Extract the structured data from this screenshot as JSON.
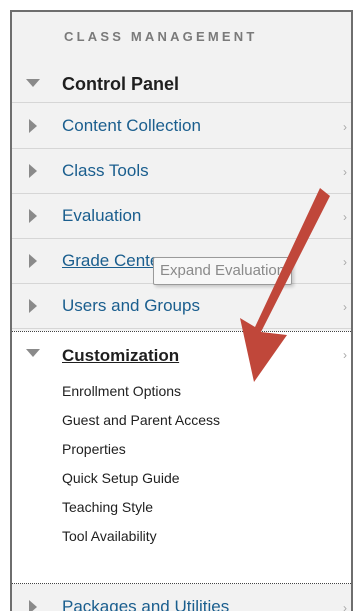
{
  "section_heading": "CLASS MANAGEMENT",
  "control_panel": {
    "label": "Control Panel"
  },
  "items": [
    {
      "label": "Content Collection"
    },
    {
      "label": "Class Tools"
    },
    {
      "label": "Evaluation"
    },
    {
      "label": "Grade Center"
    },
    {
      "label": "Users and Groups"
    }
  ],
  "tooltip": "Expand Evaluation",
  "customization": {
    "label": "Customization",
    "subitems": [
      "Enrollment Options",
      "Guest and Parent Access",
      "Properties",
      "Quick Setup Guide",
      "Teaching Style",
      "Tool Availability"
    ]
  },
  "packages": {
    "label": "Packages and Utilities"
  },
  "colors": {
    "link": "#1a5e8e",
    "annotation_arrow": "#c0473a"
  }
}
